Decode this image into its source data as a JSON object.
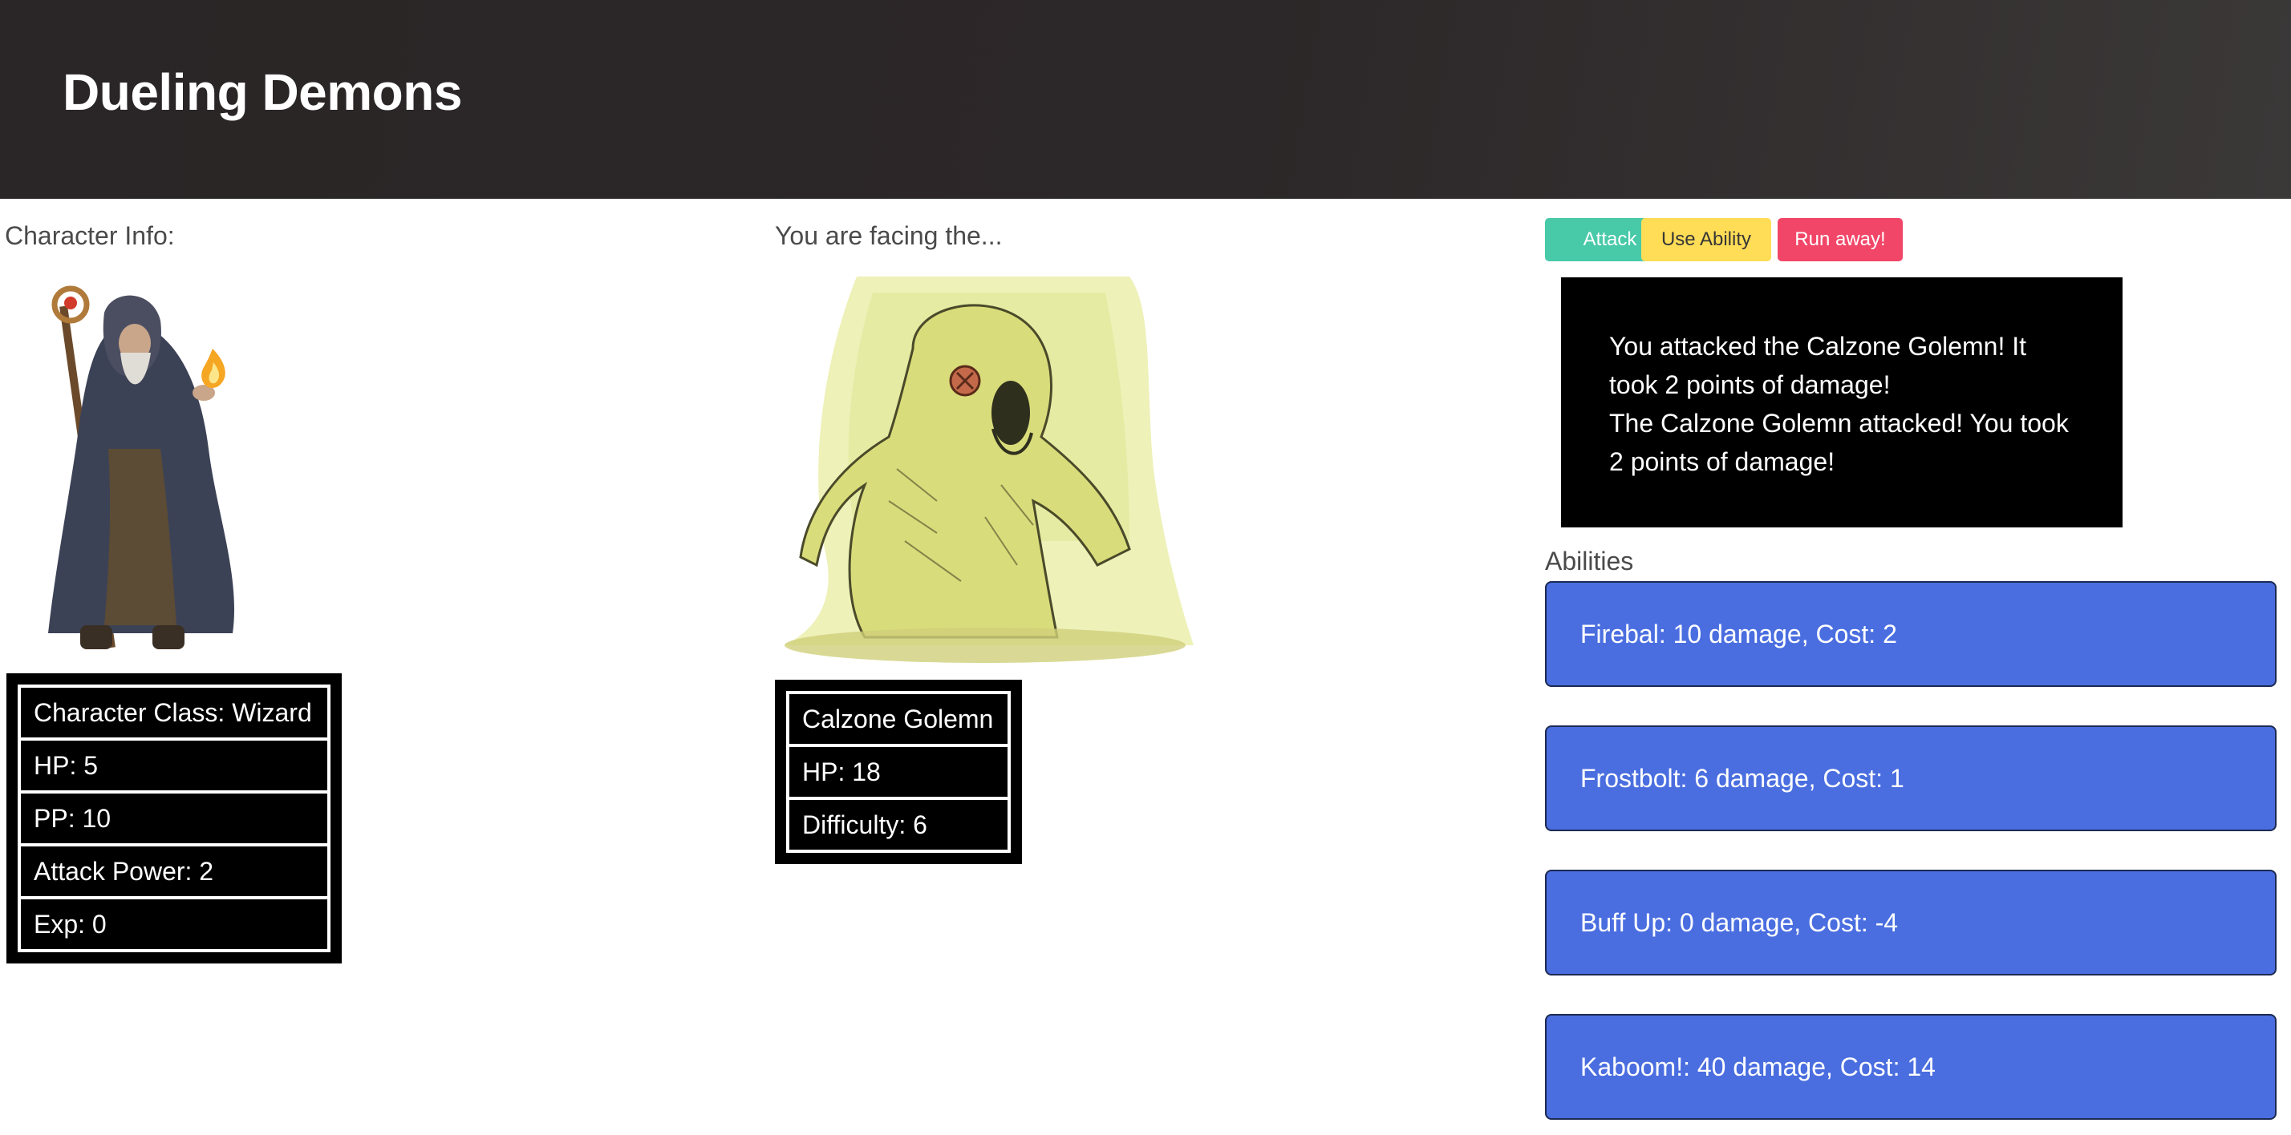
{
  "header": {
    "title": "Dueling Demons"
  },
  "character": {
    "section_label": "Character Info:",
    "image_name": "wizard-character-image",
    "stats": [
      "Character Class: Wizard",
      "HP: 5",
      "PP: 10",
      "Attack Power: 2",
      "Exp: 0"
    ]
  },
  "enemy": {
    "section_label": "You are facing the...",
    "image_name": "calzone-golemn-image",
    "stats": [
      "Calzone Golemn",
      "HP: 18",
      "Difficulty: 6"
    ]
  },
  "actions": {
    "attack_label": "Attack",
    "ability_label": "Use Ability",
    "run_label": "Run away!",
    "colors": {
      "attack": "#48c9a8",
      "ability": "#ffdd57",
      "run": "#f14668"
    }
  },
  "battle_log": [
    "You attacked the Calzone Golemn! It took 2 points of damage!",
    "The Calzone Golemn attacked! You took 2 points of damage!"
  ],
  "abilities": {
    "label": "Abilities",
    "items": [
      "Firebal: 10 damage, Cost: 2",
      "Frostbolt: 6 damage, Cost: 1",
      "Buff Up: 0 damage, Cost: -4",
      "Kaboom!: 40 damage, Cost: 14"
    ],
    "color": "#4a6ee0"
  }
}
